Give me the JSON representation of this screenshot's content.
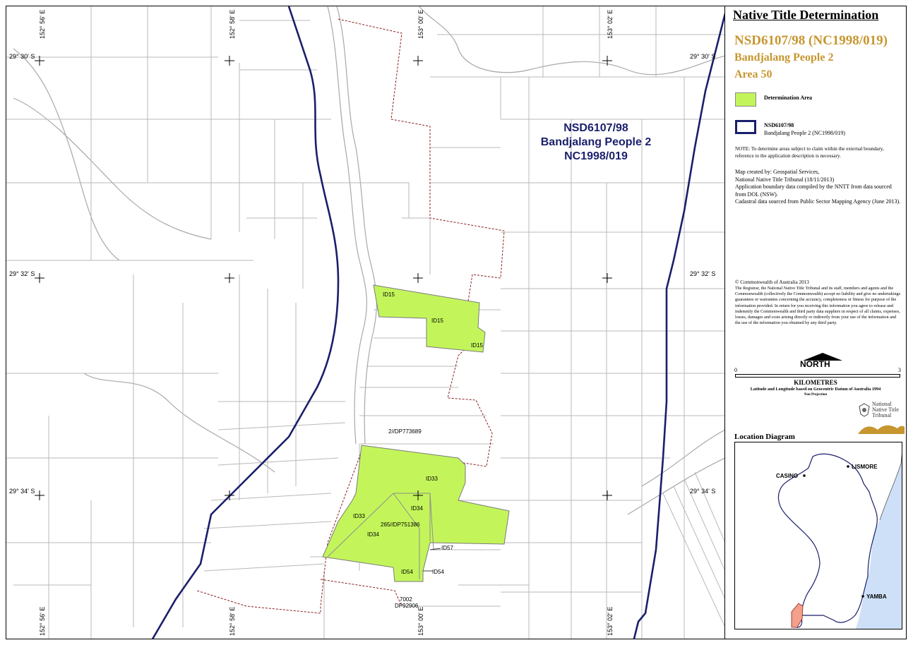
{
  "map": {
    "application_label": [
      "NSD6107/98",
      "Bandjalang People 2",
      "NC1998/019"
    ],
    "top_longitudes": [
      "152° 56' E",
      "152° 58' E",
      "153° 00' E",
      "153° 02' E"
    ],
    "bottom_longitudes": [
      "152° 56' E",
      "152° 58' E",
      "153° 00' E",
      "153° 02' E"
    ],
    "latitudes": [
      "29° 30' S",
      "29° 32' S",
      "29° 34' S"
    ],
    "parcel_labels": [
      "ID15",
      "ID15",
      "ID15",
      "ID33",
      "ID33",
      "ID34",
      "ID34",
      "265//DP751386",
      "ID57",
      "ID54",
      "ID54",
      "2//DP773689",
      "7002",
      "DP92906"
    ]
  },
  "panel": {
    "title": "Native Title Determination",
    "application": "NSD6107/98 (NC1998/019)",
    "people": "Bandjalang People 2",
    "area": "Area 50",
    "legend": {
      "determination_area": "Determination Area",
      "determination_color": "#c3f55b",
      "boundary_line1": "NSD6107/98",
      "boundary_line2": "Bandjalang People 2 (NC1998/019)",
      "boundary_color": "#1a1f6b"
    },
    "note": "NOTE: To determine areas subject to claim within the external boundary, reference to the application description is necessary.",
    "credits": [
      "Map created by: Geospatial Services,",
      "National Native Title Tribunal   (18/11/2013)",
      "Application boundary data compiled by the NNTT from data sourced from DOL (NSW).",
      "Cadastral data sourced from Public Sector Mapping Agency (June 2013)."
    ],
    "copyright": "© Commonwealth of Australia 2013",
    "disclaimer": "The Registrar, the National Native Title Tribunal and its staff, members and agents and the Commonwealth (collectively the Commonwealth) accept no liability and give no undertakings guarantees or warranties concerning the accuracy, completeness or fitness for purpose of the information provided. In return for you receiving this information you agree to release and indemnify the Commonwealth and third party data suppliers in respect of all claims, expenses, losses, damages and costs arising directly or indirectly from your use of the information and the use of the information you obtained by any third party.",
    "north": "NORTH",
    "scale": {
      "start": "0",
      "end": "3",
      "unit": "KILOMETRES"
    },
    "datum": "Latitude and Longitude based on Geocentric Datum of Australia 1994",
    "projection": "Non Projection",
    "logo_text": [
      "National",
      "Native Title",
      "Tribunal"
    ],
    "location": {
      "title": "Location Diagram",
      "towns": [
        "LISMORE",
        "CASINO",
        "YAMBA"
      ],
      "ocean_color": "#cde0f7",
      "highlight_color": "#f4a08a"
    }
  }
}
